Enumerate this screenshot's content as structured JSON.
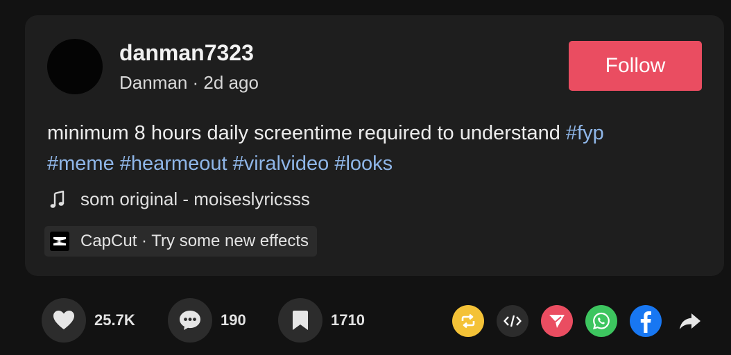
{
  "post": {
    "username": "danman7323",
    "display_name": "Danman",
    "separator": "·",
    "time_ago": "2d ago",
    "follow_label": "Follow",
    "caption_text": "minimum 8 hours daily screentime required to understand",
    "hashtags": [
      "#fyp",
      "#meme",
      "#hearmeout",
      "#viralvideo",
      "#looks"
    ],
    "music": {
      "icon": "music-note-icon",
      "title": "som original - moiseslyricsss"
    },
    "capcut": {
      "icon": "capcut-logo-icon",
      "label": "CapCut · Try some new effects"
    }
  },
  "actions": {
    "like": {
      "icon": "heart-icon",
      "count": "25.7K"
    },
    "comment": {
      "icon": "comment-icon",
      "count": "190"
    },
    "save": {
      "icon": "bookmark-icon",
      "count": "1710"
    }
  },
  "share": [
    {
      "icon": "repost-icon",
      "color": "#f4c237"
    },
    {
      "icon": "embed-icon",
      "color": "#2c2c2c"
    },
    {
      "icon": "send-icon",
      "color": "#ea4d61"
    },
    {
      "icon": "whatsapp-icon",
      "color": "#3dc55f"
    },
    {
      "icon": "facebook-icon",
      "color": "#1877f2"
    },
    {
      "icon": "share-arrow-icon",
      "color": "transparent"
    }
  ],
  "colors": {
    "accent": "#ea4d61",
    "hashtag": "#8fb6e8",
    "card_bg": "#1e1e1e",
    "page_bg": "#121212"
  }
}
